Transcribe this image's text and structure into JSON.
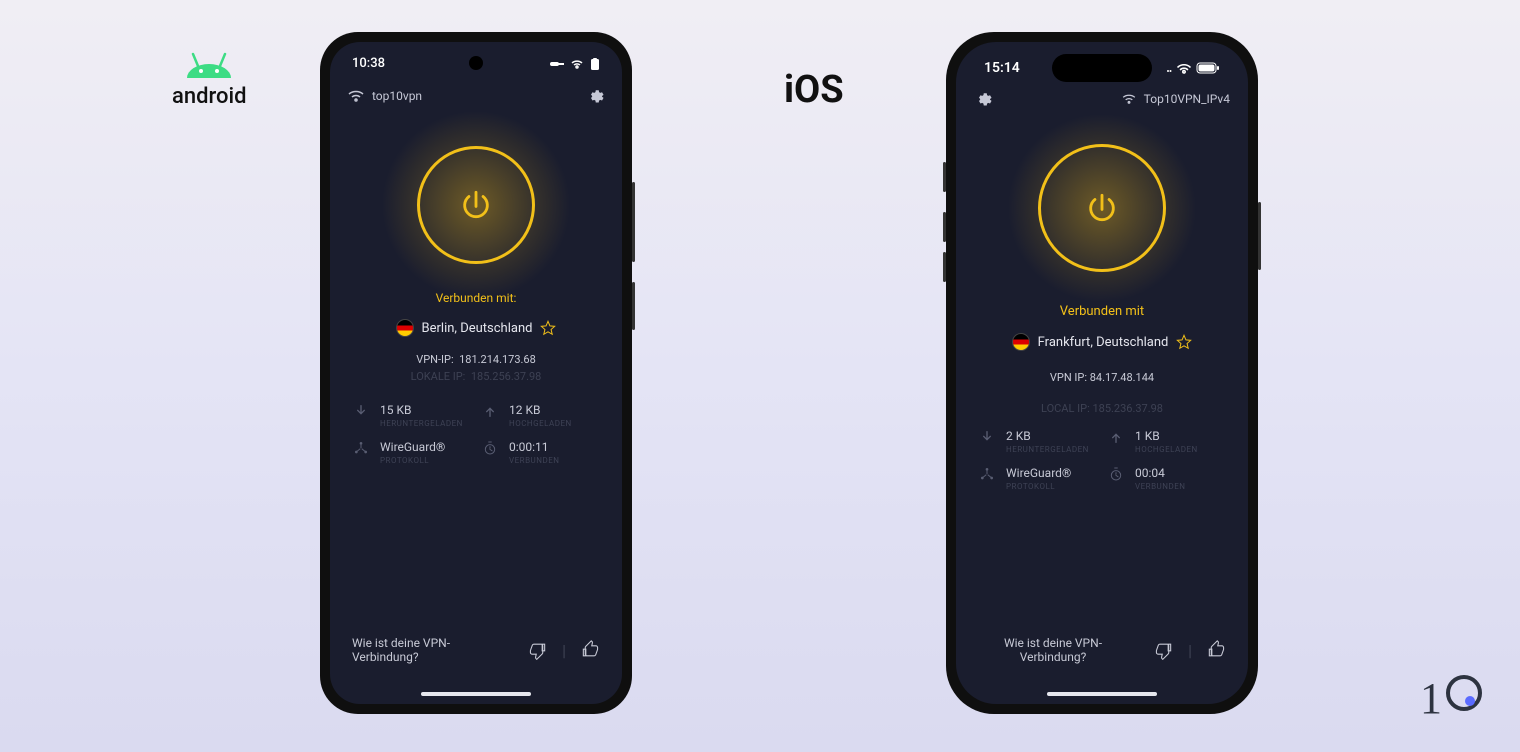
{
  "labels": {
    "android": "android",
    "ios": "iOS"
  },
  "android": {
    "status_time": "10:38",
    "network_name": "top10vpn",
    "connected_label": "Verbunden mit:",
    "location": "Berlin, Deutschland",
    "vpn_ip_label": "VPN-IP:",
    "vpn_ip": "181.214.173.68",
    "local_ip_label": "LOKALE IP:",
    "local_ip": "185.256.37.98",
    "stats": {
      "download": {
        "value": "15 KB",
        "label": "HERUNTERGELADEN"
      },
      "upload": {
        "value": "12 KB",
        "label": "HOCHGELADEN"
      },
      "protocol": {
        "value": "WireGuard®",
        "label": "PROTOKOLL"
      },
      "duration": {
        "value": "0:00:11",
        "label": "VERBUNDEN"
      }
    },
    "feedback_question": "Wie ist deine VPN-Verbindung?"
  },
  "ios": {
    "status_time": "15:14",
    "network_name": "Top10VPN_IPv4",
    "connected_label": "Verbunden mit",
    "location": "Frankfurt, Deutschland",
    "vpn_ip_label": "VPN IP:",
    "vpn_ip": "84.17.48.144",
    "local_ip_label": "LOCAL IP:",
    "local_ip": "185.236.37.98",
    "stats": {
      "download": {
        "value": "2 KB",
        "label": "HERUNTERGELADEN"
      },
      "upload": {
        "value": "1 KB",
        "label": "HOCHGELADEN"
      },
      "protocol": {
        "value": "WireGuard®",
        "label": "PROTOKOLL"
      },
      "duration": {
        "value": "00:04",
        "label": "VERBUNDEN"
      }
    },
    "feedback_question": "Wie ist deine VPN-Verbindung?"
  },
  "colors": {
    "accent": "#f2c019"
  }
}
